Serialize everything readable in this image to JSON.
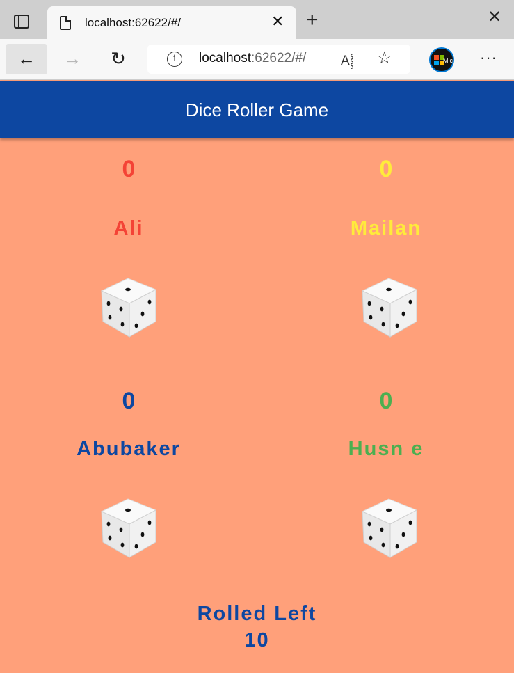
{
  "browser": {
    "tab_title": "localhost:62622/#/",
    "tab_close": "✕",
    "new_tab": "+",
    "url_host": "localhost",
    "url_rest": ":62622/#/",
    "read_aloud": "A⸾",
    "more": "···",
    "profile_text": "Micro"
  },
  "app": {
    "title": "Dice Roller Game"
  },
  "players": [
    {
      "name": "Ali",
      "score": "0",
      "color": "#f44336",
      "die_face": 5
    },
    {
      "name": "Mailan",
      "score": "0",
      "color": "#ffeb3b",
      "die_face": 5
    },
    {
      "name": "Abubaker",
      "score": "0",
      "color": "#0d47a1",
      "die_face": 5
    },
    {
      "name": "Husn e",
      "score": "0",
      "color": "#4caf50",
      "die_face": 5
    }
  ],
  "rolled": {
    "label": "Rolled Left",
    "value": "10"
  },
  "colors": {
    "background": "#ffa07a",
    "appbar": "#0d47a1"
  }
}
